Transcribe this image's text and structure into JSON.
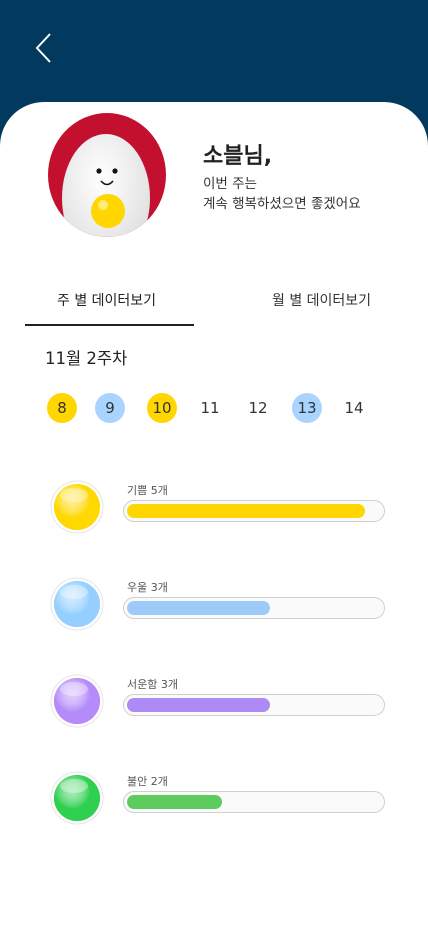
{
  "header": {
    "back_icon": "chevron-left-icon"
  },
  "profile": {
    "name": "소블님,",
    "message_line1": "이번 주는",
    "message_line2": "계속 행복하셨으면 좋겠어요"
  },
  "tabs": [
    {
      "label": "주 별 데이터보기",
      "active": true
    },
    {
      "label": "월 별 데이터보기",
      "active": false
    }
  ],
  "week": {
    "title": "11월 2주차",
    "days": [
      {
        "label": "8",
        "color": "#FFD600"
      },
      {
        "label": "9",
        "color": "#A8D4FF"
      },
      {
        "label": "10",
        "color": "#FFD600"
      },
      {
        "label": "11",
        "color": null
      },
      {
        "label": "12",
        "color": null
      },
      {
        "label": "13",
        "color": "#A8D4FF"
      },
      {
        "label": "14",
        "color": null
      }
    ]
  },
  "emotions": [
    {
      "label": "기쁨 5개",
      "count": 5,
      "max": 5,
      "color": "#FFD600",
      "orb": "#FFD800"
    },
    {
      "label": "우울 3개",
      "count": 3,
      "max": 5,
      "color": "#9CCBFA",
      "orb": "#95CFFF"
    },
    {
      "label": "서운함 3개",
      "count": 3,
      "max": 5,
      "color": "#AE8AF5",
      "orb": "#B58BFA"
    },
    {
      "label": "불안 2개",
      "count": 2,
      "max": 5,
      "color": "#5DCB5D",
      "orb": "#2FD050"
    }
  ]
}
